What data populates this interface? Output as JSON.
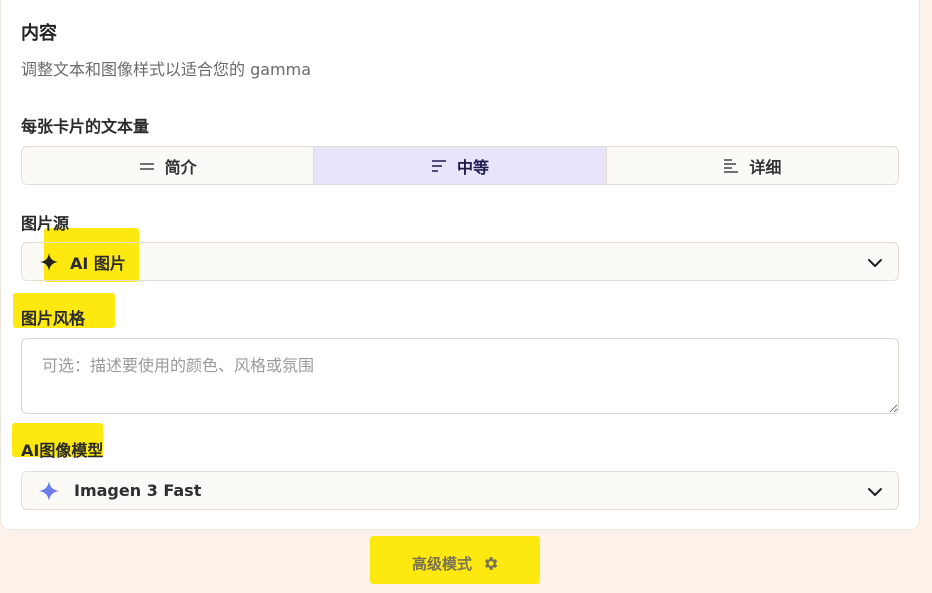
{
  "content": {
    "title": "内容",
    "subtitle": "调整文本和图像样式以适合您的 gamma"
  },
  "text_amount": {
    "label": "每张卡片的文本量",
    "options": [
      {
        "label": "简介",
        "icon": "equals-lines-icon",
        "active": false
      },
      {
        "label": "中等",
        "icon": "medium-lines-icon",
        "active": true
      },
      {
        "label": "详细",
        "icon": "detailed-lines-icon",
        "active": false
      }
    ]
  },
  "image_source": {
    "label": "图片源",
    "value": "AI 图片",
    "icon": "sparkle-icon"
  },
  "image_style": {
    "label": "图片风格",
    "placeholder": "可选：描述要使用的颜色、风格或氛围"
  },
  "ai_model": {
    "label": "AI图像模型",
    "value": "Imagen 3 Fast",
    "icon": "gemini-star-icon"
  },
  "advanced": {
    "label": "高级模式",
    "icon": "gear-icon"
  },
  "colors": {
    "highlight": "#fde910",
    "active_segment": "#e7e4fb",
    "page_background": "#fdf3ea"
  }
}
